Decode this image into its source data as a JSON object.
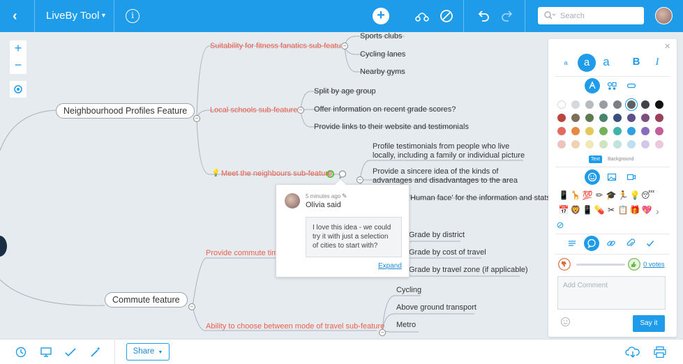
{
  "app": {
    "title": "LiveBy Tool"
  },
  "search": {
    "placeholder": "Search"
  },
  "mindmap": {
    "root1": "Neighbourhood Profiles Feature",
    "root2": "Commute feature",
    "sub_fitness": "Suitability for fitness fanatics sub-feature",
    "fitness_items": [
      "Sports clubs",
      "Cycling lanes",
      "Nearby gyms"
    ],
    "sub_schools": "Local schools sub-feature",
    "schools_items": [
      "Split by age group",
      "Offer information on recent grade scores?",
      "Provide links to their website and testimonials"
    ],
    "sub_neighbours": "Meet the neighbours sub-feature",
    "neighbours_items": [
      "Profile testimonials from people who live locally, including a family or individual picture",
      "Provide a sincere idea of the kinds of advantages and disadvantages to the area",
      "'Human face' for the information and stats"
    ],
    "sub_commute_time": "Provide commute time",
    "commute_time_items": [
      "Grade by district",
      "Grade by cost of travel",
      "Grade by travel zone (if applicable)"
    ],
    "sub_travel_mode": "Ability to choose between mode of travel sub-feature",
    "travel_mode_items": [
      "Cycling",
      "Above ground transport",
      "Metro"
    ]
  },
  "comment_popup": {
    "time": "5 minutes ago",
    "author": "Olivia said",
    "text": "I love this idea - we could try it with just a selection of cities to start with?",
    "expand": "Expand"
  },
  "panel": {
    "font_sizes": [
      "a",
      "a",
      "a"
    ],
    "bold": "B",
    "italic": "I",
    "tabs": {
      "text": "Text",
      "background": "Background"
    },
    "swatches": [
      [
        "#ffffff",
        "#d5d8dc",
        "#b7bbbf",
        "#999da1",
        "#7b7f83",
        "#5d6165",
        "#3f4347",
        "#111111"
      ],
      [
        "#b9453c",
        "#7d6e58",
        "#5f7a4f",
        "#47846c",
        "#39507c",
        "#5c4f8a",
        "#7d4f7c",
        "#9c3f5a"
      ],
      [
        "#e26a5f",
        "#e58a43",
        "#e2c95a",
        "#73b25c",
        "#3fb3a7",
        "#2fa0e0",
        "#8a6bbd",
        "#c35e9b"
      ],
      [
        "#ecc3bf",
        "#efd2b3",
        "#f0e8b8",
        "#cde4bf",
        "#bfe4df",
        "#bedff2",
        "#d4c8e8",
        "#ebc8db"
      ]
    ],
    "selected_swatch": "#5d6165",
    "emojis": [
      "📱",
      "🦒",
      "💯",
      "✏",
      "🎓",
      "🏃",
      "💡",
      "😴",
      "📅",
      "🦁",
      "📱",
      "💊",
      "✂",
      "📋",
      "🎁",
      "💖"
    ],
    "votes": "0 votes",
    "comment_placeholder": "Add Comment",
    "say_it": "Say it"
  },
  "bottom": {
    "share": "Share"
  }
}
